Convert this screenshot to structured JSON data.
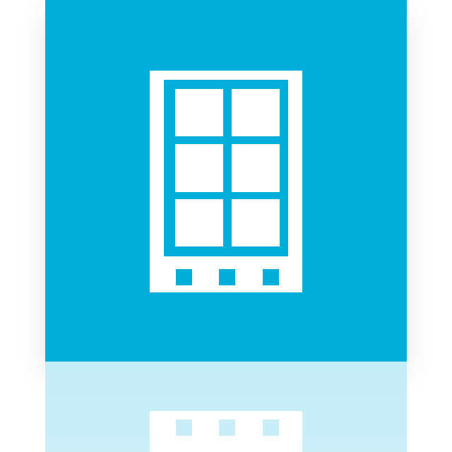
{
  "icon": {
    "name": "tablet-icon",
    "tile_color": "#00AEDB",
    "glyph_color": "#FFFFFF",
    "reflection_color": "#C3ECF7",
    "tile_grid": {
      "rows": 3,
      "columns": 2
    },
    "nav_buttons": 3
  }
}
